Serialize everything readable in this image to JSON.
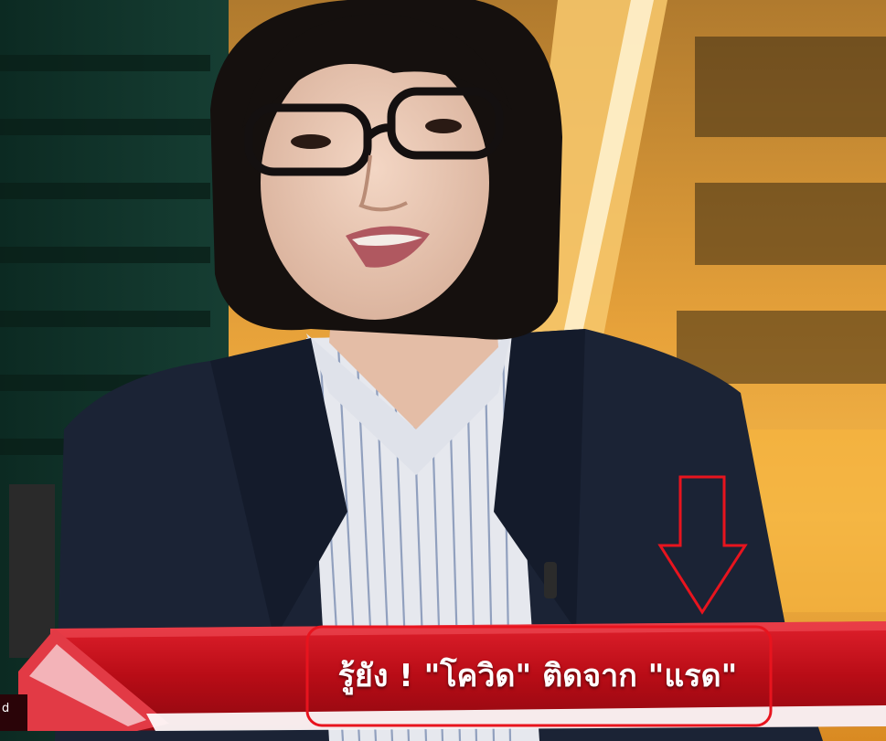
{
  "headline": {
    "text": "รู้ยัง ! \"โควิด\" ติดจาก \"แรด\""
  },
  "ticker_fragment": "d",
  "colors": {
    "banner_red": "#c8101c",
    "highlight_outline": "#e8141e",
    "arrow": "#e8141e",
    "jacket": "#1b2335",
    "background_gold": "#e7a23a"
  }
}
